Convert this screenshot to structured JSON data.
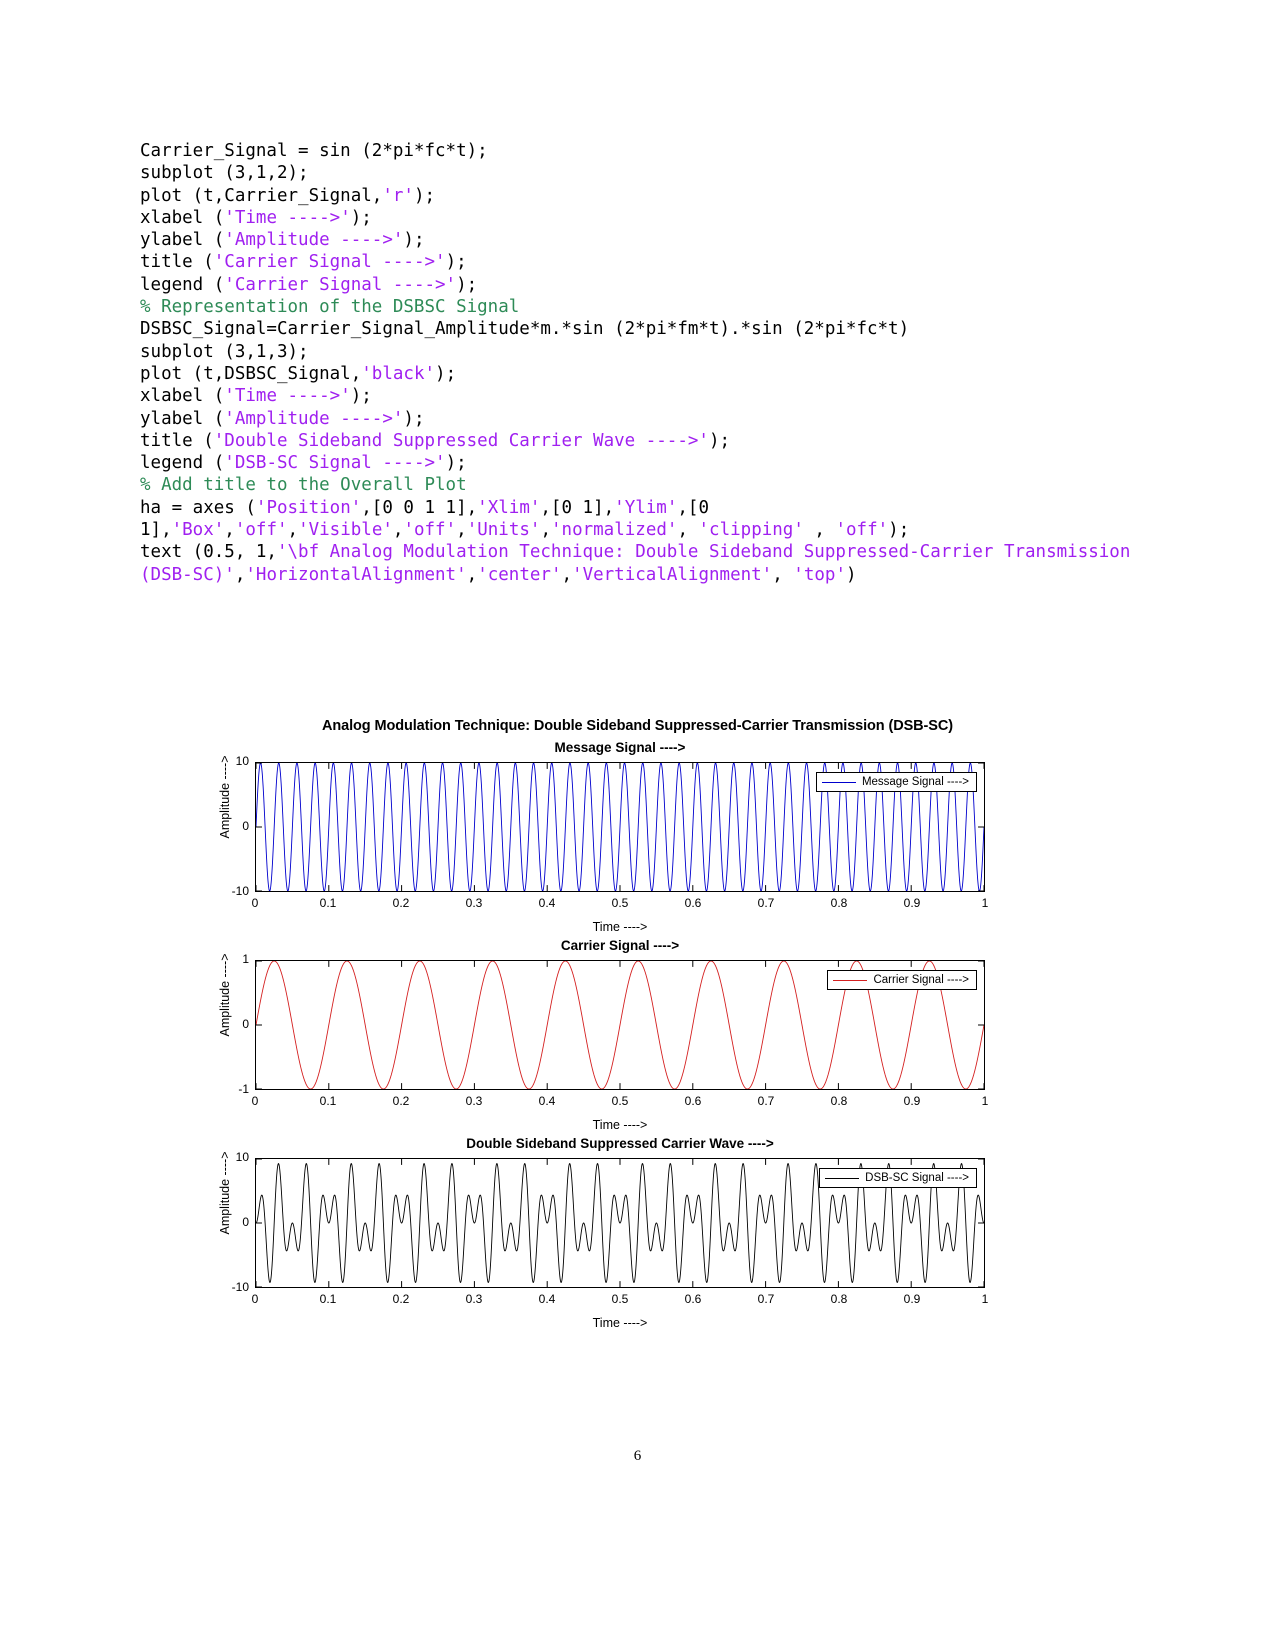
{
  "document": {
    "page_number": "6",
    "code_lines": [
      [
        {
          "t": "Carrier_Signal = sin (2*pi*fc*t);",
          "c": "plain"
        }
      ],
      [
        {
          "t": "subplot (3,1,2);",
          "c": "plain"
        }
      ],
      [
        {
          "t": "plot (t,Carrier_Signal,",
          "c": "plain"
        },
        {
          "t": "'r'",
          "c": "str"
        },
        {
          "t": ");",
          "c": "plain"
        }
      ],
      [
        {
          "t": "xlabel (",
          "c": "plain"
        },
        {
          "t": "'Time ---->'",
          "c": "str"
        },
        {
          "t": ");",
          "c": "plain"
        }
      ],
      [
        {
          "t": "ylabel (",
          "c": "plain"
        },
        {
          "t": "'Amplitude ---->'",
          "c": "str"
        },
        {
          "t": ");",
          "c": "plain"
        }
      ],
      [
        {
          "t": "title (",
          "c": "plain"
        },
        {
          "t": "'Carrier Signal ---->'",
          "c": "str"
        },
        {
          "t": ");",
          "c": "plain"
        }
      ],
      [
        {
          "t": "legend (",
          "c": "plain"
        },
        {
          "t": "'Carrier Signal ---->'",
          "c": "str"
        },
        {
          "t": ");",
          "c": "plain"
        }
      ],
      [
        {
          "t": "% Representation of the DSBSC Signal",
          "c": "cmt"
        }
      ],
      [
        {
          "t": "DSBSC_Signal=Carrier_Signal_Amplitude*m.*sin (2*pi*fm*t).*sin (2*pi*fc*t)",
          "c": "plain"
        }
      ],
      [
        {
          "t": "subplot (3,1,3);",
          "c": "plain"
        }
      ],
      [
        {
          "t": "plot (t,DSBSC_Signal,",
          "c": "plain"
        },
        {
          "t": "'black'",
          "c": "str"
        },
        {
          "t": ");",
          "c": "plain"
        }
      ],
      [
        {
          "t": "xlabel (",
          "c": "plain"
        },
        {
          "t": "'Time ---->'",
          "c": "str"
        },
        {
          "t": ");",
          "c": "plain"
        }
      ],
      [
        {
          "t": "ylabel (",
          "c": "plain"
        },
        {
          "t": "'Amplitude ---->'",
          "c": "str"
        },
        {
          "t": ");",
          "c": "plain"
        }
      ],
      [
        {
          "t": "title (",
          "c": "plain"
        },
        {
          "t": "'Double Sideband Suppressed Carrier Wave ---->'",
          "c": "str"
        },
        {
          "t": ");",
          "c": "plain"
        }
      ],
      [
        {
          "t": "legend (",
          "c": "plain"
        },
        {
          "t": "'DSB-SC Signal ---->'",
          "c": "str"
        },
        {
          "t": ");",
          "c": "plain"
        }
      ],
      [
        {
          "t": "% Add title to the Overall Plot",
          "c": "cmt"
        }
      ],
      [
        {
          "t": "ha = axes (",
          "c": "plain"
        },
        {
          "t": "'Position'",
          "c": "str"
        },
        {
          "t": ",[0 0 1 1],",
          "c": "plain"
        },
        {
          "t": "'Xlim'",
          "c": "str"
        },
        {
          "t": ",[0 1],",
          "c": "plain"
        },
        {
          "t": "'Ylim'",
          "c": "str"
        },
        {
          "t": ",[0 1],",
          "c": "plain"
        },
        {
          "t": "'Box'",
          "c": "str"
        },
        {
          "t": ",",
          "c": "plain"
        },
        {
          "t": "'off'",
          "c": "str"
        },
        {
          "t": ",",
          "c": "plain"
        },
        {
          "t": "'Visible'",
          "c": "str"
        },
        {
          "t": ",",
          "c": "plain"
        },
        {
          "t": "'off'",
          "c": "str"
        },
        {
          "t": ",",
          "c": "plain"
        },
        {
          "t": "'Units'",
          "c": "str"
        },
        {
          "t": ",",
          "c": "plain"
        },
        {
          "t": "'normalized'",
          "c": "str"
        },
        {
          "t": ", ",
          "c": "plain"
        },
        {
          "t": "'clipping'",
          "c": "str"
        },
        {
          "t": " , ",
          "c": "plain"
        },
        {
          "t": "'off'",
          "c": "str"
        },
        {
          "t": ");",
          "c": "plain"
        }
      ],
      [
        {
          "t": "text (0.5, 1,",
          "c": "plain"
        },
        {
          "t": "'\\bf Analog Modulation Technique: Double Sideband Suppressed-Carrier Transmission (DSB-SC)'",
          "c": "str"
        },
        {
          "t": ",",
          "c": "plain"
        },
        {
          "t": "'HorizontalAlignment'",
          "c": "str"
        },
        {
          "t": ",",
          "c": "plain"
        },
        {
          "t": "'center'",
          "c": "str"
        },
        {
          "t": ",",
          "c": "plain"
        },
        {
          "t": "'VerticalAlignment'",
          "c": "str"
        },
        {
          "t": ", ",
          "c": "plain"
        },
        {
          "t": "'top'",
          "c": "str"
        },
        {
          "t": ")",
          "c": "plain"
        }
      ]
    ]
  },
  "chart_data": [
    {
      "type": "line",
      "title": "Message Signal ---->",
      "overall_title": "Analog Modulation Technique: Double Sideband Suppressed-Carrier Transmission (DSB-SC)",
      "xlabel": "Time ---->",
      "ylabel": "Amplitude ---->",
      "xlim": [
        0,
        1
      ],
      "ylim": [
        -10,
        10
      ],
      "xticks": [
        "0",
        "0.1",
        "0.2",
        "0.3",
        "0.4",
        "0.5",
        "0.6",
        "0.7",
        "0.8",
        "0.9",
        "1"
      ],
      "xtick_values": [
        0,
        0.1,
        0.2,
        0.3,
        0.4,
        0.5,
        0.6,
        0.7,
        0.8,
        0.9,
        1
      ],
      "yticks": [
        "-10",
        "0",
        "10"
      ],
      "ytick_values": [
        -10,
        0,
        10
      ],
      "grid": false,
      "legend": {
        "label": "Message Signal ---->",
        "position": "top-right"
      },
      "color": "#0000cd",
      "series": [
        {
          "name": "Message Signal ---->",
          "waveform": "sine",
          "amplitude": 10,
          "frequency_hz": 40,
          "phase": 0
        }
      ]
    },
    {
      "type": "line",
      "title": "Carrier Signal ---->",
      "xlabel": "Time ---->",
      "ylabel": "Amplitude ---->",
      "xlim": [
        0,
        1
      ],
      "ylim": [
        -1,
        1
      ],
      "xticks": [
        "0",
        "0.1",
        "0.2",
        "0.3",
        "0.4",
        "0.5",
        "0.6",
        "0.7",
        "0.8",
        "0.9",
        "1"
      ],
      "xtick_values": [
        0,
        0.1,
        0.2,
        0.3,
        0.4,
        0.5,
        0.6,
        0.7,
        0.8,
        0.9,
        1
      ],
      "yticks": [
        "-1",
        "0",
        "1"
      ],
      "ytick_values": [
        -1,
        0,
        1
      ],
      "grid": false,
      "legend": {
        "label": "Carrier Signal ---->",
        "position": "top-right"
      },
      "color": "#d42020",
      "series": [
        {
          "name": "Carrier Signal ---->",
          "waveform": "sine",
          "amplitude": 1,
          "frequency_hz": 10,
          "phase": 0
        }
      ]
    },
    {
      "type": "line",
      "title": "Double Sideband Suppressed Carrier Wave ---->",
      "xlabel": "Time ---->",
      "ylabel": "Amplitude ---->",
      "xlim": [
        0,
        1
      ],
      "ylim": [
        -10,
        10
      ],
      "xticks": [
        "0",
        "0.1",
        "0.2",
        "0.3",
        "0.4",
        "0.5",
        "0.6",
        "0.7",
        "0.8",
        "0.9",
        "1"
      ],
      "xtick_values": [
        0,
        0.1,
        0.2,
        0.3,
        0.4,
        0.5,
        0.6,
        0.7,
        0.8,
        0.9,
        1
      ],
      "yticks": [
        "-10",
        "0",
        "10"
      ],
      "ytick_values": [
        -10,
        0,
        10
      ],
      "grid": false,
      "legend": {
        "label": "DSB-SC Signal ---->",
        "position": "top-right"
      },
      "color": "#000000",
      "series": [
        {
          "name": "DSB-SC Signal ---->",
          "waveform": "product-of-sines",
          "amplitude": 10,
          "message_frequency_hz": 40,
          "carrier_frequency_hz": 10,
          "phase": 0
        }
      ]
    }
  ]
}
